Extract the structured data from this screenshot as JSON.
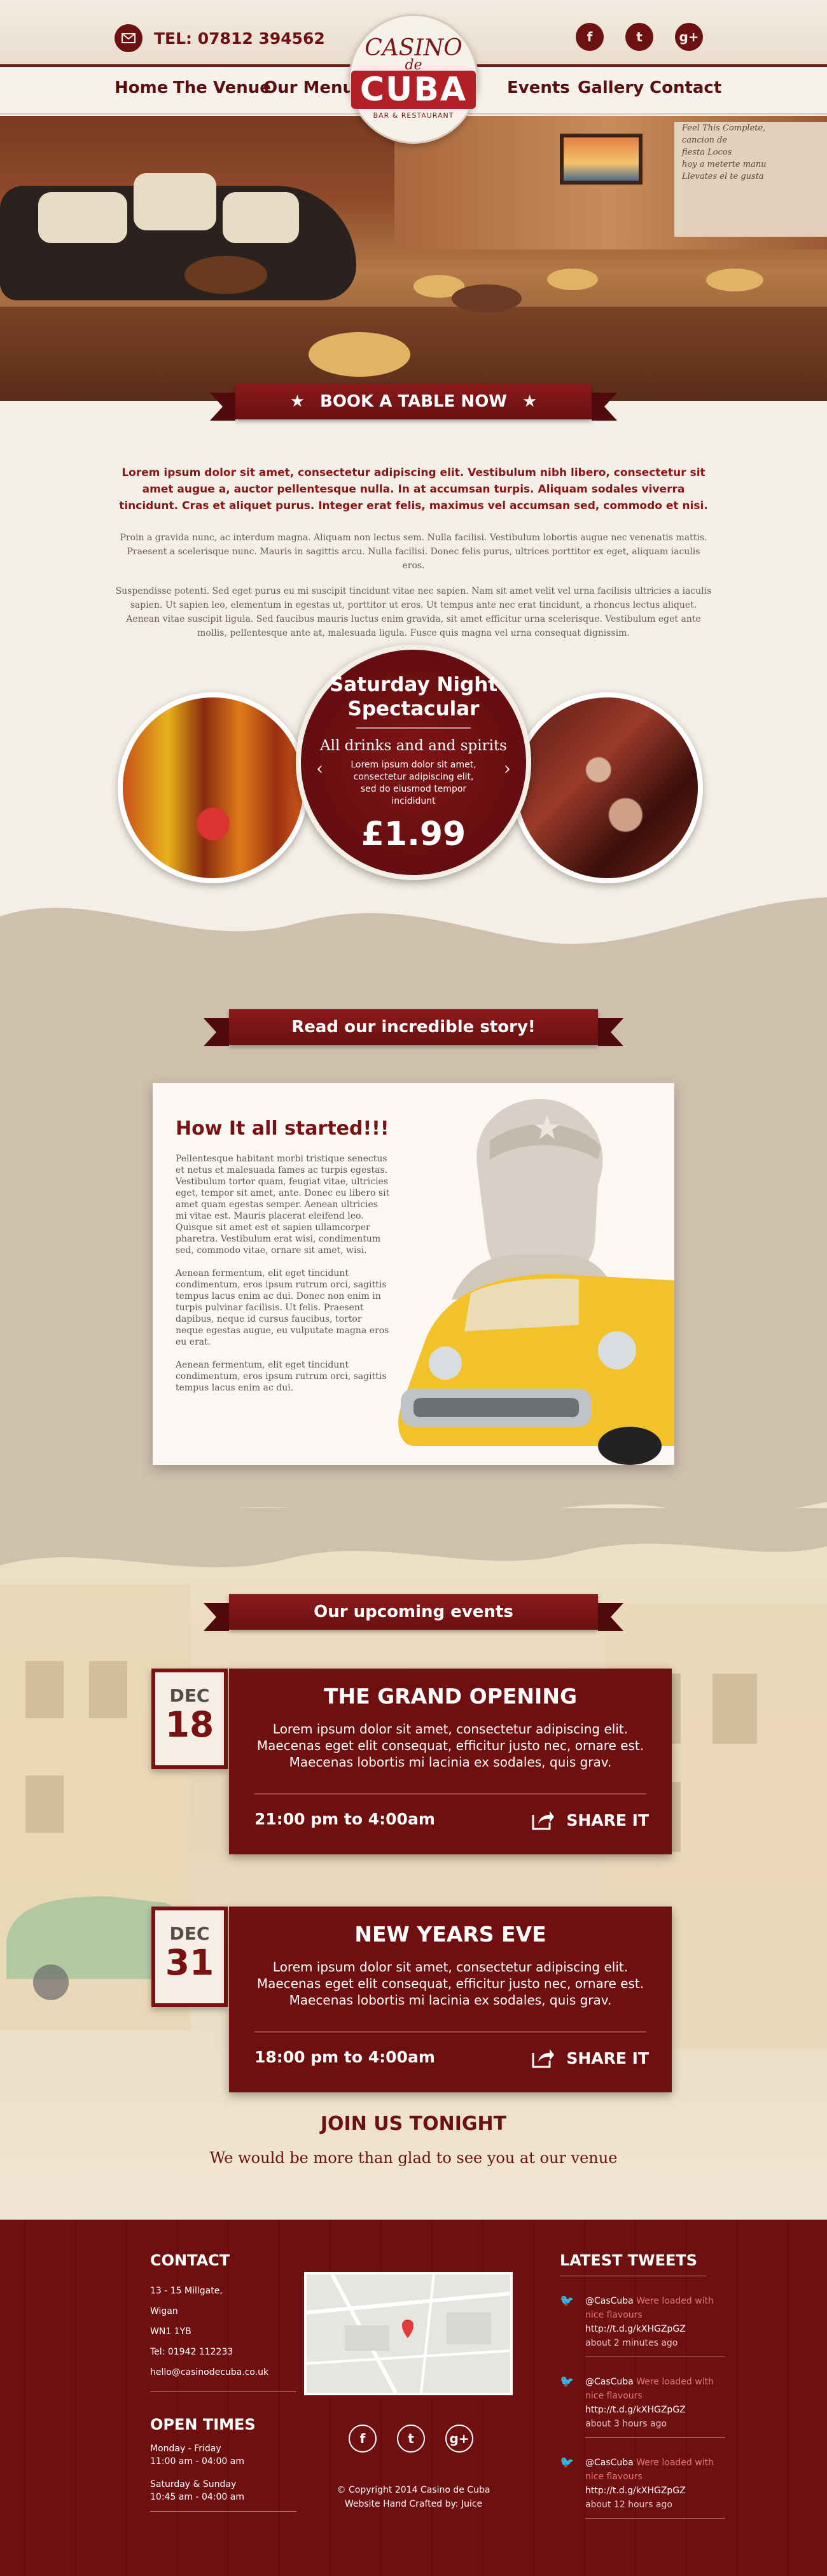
{
  "header": {
    "phone_label": "TEL: 07812 394562",
    "email_icon": "envelope-icon",
    "social": [
      {
        "name": "facebook-icon",
        "glyph": "f"
      },
      {
        "name": "twitter-icon",
        "glyph": "t"
      },
      {
        "name": "googleplus-icon",
        "glyph": "g+"
      }
    ]
  },
  "nav": {
    "left": [
      "Home",
      "The Venue",
      "Our Menu"
    ],
    "right": [
      "Events",
      "Gallery",
      "Contact"
    ]
  },
  "logo": {
    "line1": "CASINO",
    "line2": "de",
    "line3": "CUBA",
    "line4": "BAR & RESTAURANT"
  },
  "hero": {
    "board_lines": [
      "Feel This Complete,",
      "cancion de",
      "fiesta Locos",
      "hoy a meterte manu",
      "Llevates el te gusta"
    ],
    "book_label": "BOOK A TABLE NOW"
  },
  "intro": {
    "lead": "Lorem ipsum dolor sit amet, consectetur adipiscing elit. Vestibulum nibh libero, consectetur sit amet augue a, auctor pellentesque nulla. In at accumsan turpis. Aliquam sodales viverra tincidunt. Cras et aliquet purus. Integer erat felis, maximus vel accumsan sed, commodo et nisi.",
    "p1": "Proin a gravida nunc, ac interdum magna. Aliquam non lectus sem. Nulla facilisi. Vestibulum lobortis augue nec venenatis mattis. Praesent a scelerisque nunc. Mauris in sagittis arcu. Nulla facilisi. Donec felis purus, ultrices porttitor ex eget, aliquam iaculis eros.",
    "p2": "Suspendisse potenti. Sed eget purus eu mi suscipit tincidunt vitae nec sapien. Nam sit amet velit vel urna facilisis ultricies a iaculis sapien. Ut sapien leo, elementum in egestas ut, porttitor ut eros. Ut tempus ante nec erat tincidunt, a rhoncus lectus aliquet. Aenean vitae suscipit ligula. Sed faucibus mauris luctus enim gravida, sit amet efficitur urna scelerisque. Vestibulum eget ante mollis, pellentesque ante at, malesuada ligula. Fusce quis magna vel urna consequat dignissim."
  },
  "offer": {
    "title": "Saturday Night Spectacular",
    "sub": "All drinks and and spirits",
    "desc": "Lorem ipsum dolor sit amet, consectetur adipiscing elit, sed do eiusmod tempor incididunt",
    "price": "£1.99"
  },
  "story": {
    "banner": "Read our incredible story!",
    "heading": "How It all started!!!",
    "paragraphs": [
      "Pellentesque habitant morbi tristique senectus et netus et malesuada fames ac turpis egestas. Vestibulum tortor quam, feugiat vitae, ultricies eget, tempor sit amet, ante. Donec eu libero sit amet quam egestas semper. Aenean ultricies mi vitae est. Mauris placerat eleifend leo. Quisque sit amet est et sapien ullamcorper pharetra. Vestibulum erat wisi, condimentum sed, commodo vitae, ornare sit amet, wisi.",
      "Aenean fermentum, elit eget tincidunt condimentum, eros ipsum rutrum orci, sagittis tempus lacus enim ac dui. Donec non enim in turpis pulvinar facilisis. Ut felis. Praesent dapibus, neque id cursus faucibus, tortor neque egestas augue, eu vulputate magna eros eu erat.",
      "Aenean fermentum, elit eget tincidunt condimentum, eros ipsum rutrum orci, sagittis tempus lacus enim ac dui."
    ]
  },
  "events": {
    "banner": "Our upcoming events",
    "items": [
      {
        "month": "DEC",
        "day": "18",
        "title": "THE GRAND OPENING",
        "desc": "Lorem ipsum dolor sit amet, consectetur adipiscing elit. Maecenas eget elit consequat, efficitur justo nec, ornare est. Maecenas lobortis mi lacinia ex sodales, quis grav.",
        "time": "21:00 pm to 4:00am",
        "share": "SHARE IT"
      },
      {
        "month": "DEC",
        "day": "31",
        "title": "NEW YEARS EVE",
        "desc": "Lorem ipsum dolor sit amet, consectetur adipiscing elit. Maecenas eget elit consequat, efficitur justo nec, ornare est. Maecenas lobortis mi lacinia ex sodales, quis grav.",
        "time": "18:00 pm to 4:00am",
        "share": "SHARE IT"
      }
    ],
    "join_heading": "JOIN US TONIGHT",
    "join_sub": "We would be more than glad to see you  at our venue"
  },
  "footer": {
    "contact_heading": "CONTACT",
    "contact_lines": [
      "13 - 15 Millgate,",
      "Wigan",
      "WN1 1YB",
      "Tel: 01942 112233",
      "hello@casinodecuba.co.uk"
    ],
    "times_heading": "OPEN TIMES",
    "times": [
      {
        "days": "Monday - Friday",
        "hours": "11:00 am - 04:00 am"
      },
      {
        "days": "Saturday & Sunday",
        "hours": "10:45 am - 04:00 am"
      }
    ],
    "copyright": "© Copyright 2014 Casino de Cuba",
    "crafted": "Website Hand Crafted by: Juice",
    "tweets_heading": "LATEST TWEETS",
    "tweets": [
      {
        "handle": "@CasCuba",
        "text": "Were loaded with nice flavours",
        "link": "http://t.d.g/kXHGZpGZ",
        "ago": "about 2 minutes ago"
      },
      {
        "handle": "@CasCuba",
        "text": "Were loaded with nice flavours",
        "link": "http://t.d.g/kXHGZpGZ",
        "ago": "about 3 hours ago"
      },
      {
        "handle": "@CasCuba",
        "text": "Were loaded with nice flavours",
        "link": "http://t.d.g/kXHGZpGZ",
        "ago": "about 12 hours ago"
      }
    ]
  }
}
